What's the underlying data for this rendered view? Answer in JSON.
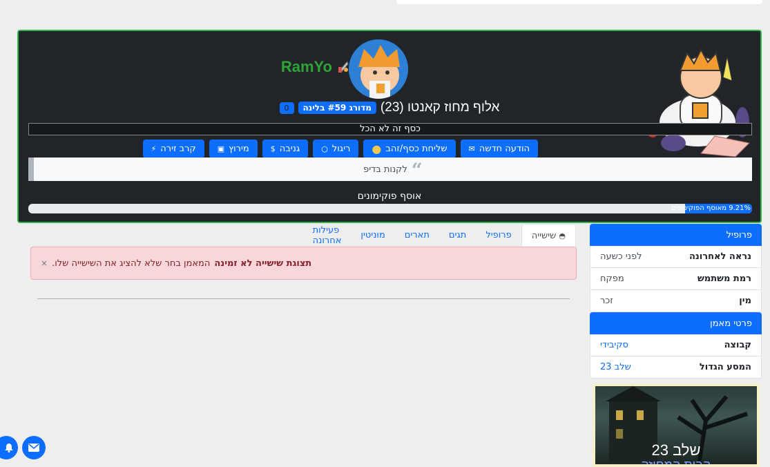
{
  "profile": {
    "username": "RamYo",
    "title": "אלוף מחוז קאנטו (23)",
    "rank_badge": "מדורג #59 בלינה",
    "count_badge": "0",
    "money_note": "כסף זה לא הכל",
    "quote": "לקנות בדיפ",
    "collection_title": "אוסף פוקימונים",
    "progress_label": "9.21% מאוסף הפוקימונים",
    "progress_value": 0.0921
  },
  "actions": [
    {
      "label": "הודעה חדשה",
      "icon": "envelope-icon"
    },
    {
      "label": "שליחת כסף/זהב",
      "icon": "coins-icon"
    },
    {
      "label": "ריגול",
      "icon": "spy-icon"
    },
    {
      "label": "גניבה",
      "icon": "dollar-icon"
    },
    {
      "label": "מירוץ",
      "icon": "car-icon"
    },
    {
      "label": "קרב זירה",
      "icon": "lightning-icon"
    }
  ],
  "tabs": [
    {
      "label": "שישייה",
      "active": true
    },
    {
      "label": "פרופיל"
    },
    {
      "label": "תגים"
    },
    {
      "label": "תארים"
    },
    {
      "label": "מוניטין"
    },
    {
      "label": "פעילות אחרונה"
    }
  ],
  "alert": {
    "close": "×",
    "title": "תצוגת שישייה לא זמינה",
    "text": "המאמן בחר שלא להציג את השישייה שלו."
  },
  "sidebar": {
    "profile_header": "פרופיל",
    "profile_rows": [
      {
        "key": "נראה לאחרונה",
        "value": "לפני כשעה"
      },
      {
        "key": "רמת משתמש",
        "value": "מפקח"
      },
      {
        "key": "מין",
        "value": "זכר"
      }
    ],
    "trainer_header": "פרטי מאמן",
    "trainer_rows": [
      {
        "key": "קבוצה",
        "value": "סקיבידי"
      },
      {
        "key": "המסע הגדול",
        "value": "שלב 23"
      }
    ],
    "stage_title": "שלב 23",
    "stage_subtitle": "הבית המחוזק"
  },
  "colors": {
    "accent": "#0d6efd",
    "username": "#2fa537",
    "hero_bg": "#212529",
    "hero_border": "#2fb54a",
    "alert_bg": "#f8d7da"
  }
}
